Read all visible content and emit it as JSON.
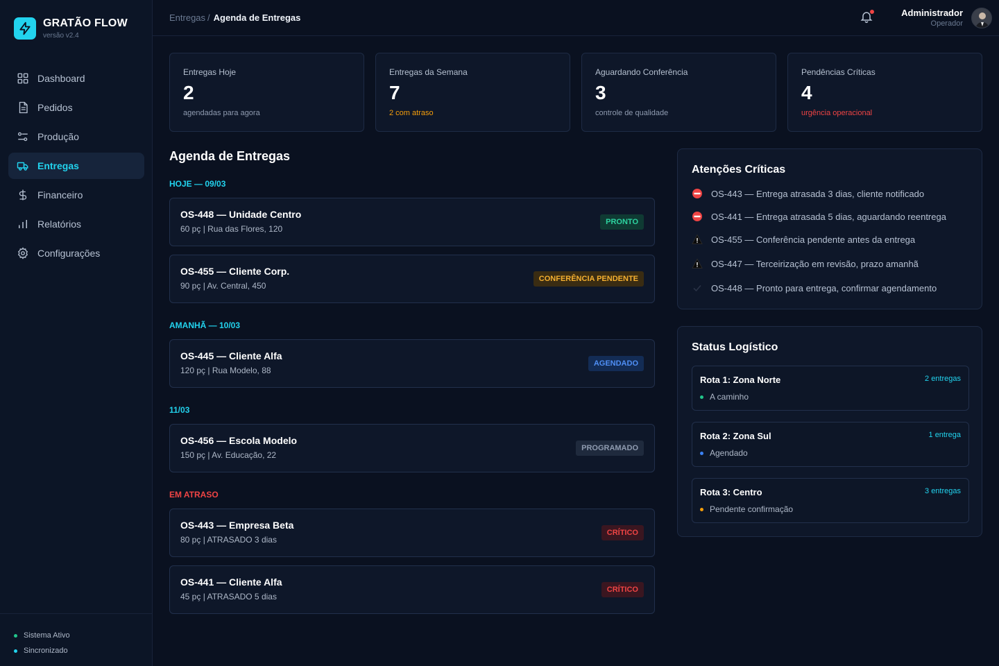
{
  "brand": {
    "name": "GRATÃO FLOW",
    "version": "versão v2.4"
  },
  "nav": [
    {
      "label": "Dashboard",
      "icon": "dashboard-icon"
    },
    {
      "label": "Pedidos",
      "icon": "document-icon"
    },
    {
      "label": "Produção",
      "icon": "sliders-icon"
    },
    {
      "label": "Entregas",
      "icon": "truck-icon",
      "active": true
    },
    {
      "label": "Financeiro",
      "icon": "dollar-icon"
    },
    {
      "label": "Relatórios",
      "icon": "bar-chart-icon"
    },
    {
      "label": "Configurações",
      "icon": "gear-icon"
    }
  ],
  "system_status": [
    {
      "label": "Sistema Ativo",
      "color": "#22c58b"
    },
    {
      "label": "Sincronizado",
      "color": "#22d3ee"
    }
  ],
  "breadcrumb": {
    "parent": "Entregas",
    "separator": "/",
    "current": "Agenda de Entregas"
  },
  "user": {
    "name": "Administrador",
    "role": "Operador"
  },
  "stats": [
    {
      "label": "Entregas Hoje",
      "value": "2",
      "sub": "agendadas para agora"
    },
    {
      "label": "Entregas da Semana",
      "value": "7",
      "sub": "2 com atraso"
    },
    {
      "label": "Aguardando Conferência",
      "value": "3",
      "sub": "controle de qualidade"
    },
    {
      "label": "Pendências Críticas",
      "value": "4",
      "sub": "urgência operacional"
    }
  ],
  "agenda": {
    "title": "Agenda de Entregas",
    "groups": [
      {
        "label": "HOJE — 09/03",
        "items": [
          {
            "title": "OS-448 — Unidade Centro",
            "meta": "60 pç | Rua das Flores, 120",
            "badge": "PRONTO"
          },
          {
            "title": "OS-455 — Cliente Corp.",
            "meta": "90 pç | Av. Central, 450",
            "badge": "CONFERÊNCIA PENDENTE"
          }
        ]
      },
      {
        "label": "AMANHÃ — 10/03",
        "items": [
          {
            "title": "OS-445 — Cliente Alfa",
            "meta": "120 pç | Rua Modelo, 88",
            "badge": "AGENDADO"
          }
        ]
      },
      {
        "label": "11/03",
        "items": [
          {
            "title": "OS-456 — Escola Modelo",
            "meta": "150 pç | Av. Educação, 22",
            "badge": "PROGRAMADO"
          }
        ]
      },
      {
        "label": "EM ATRASO",
        "items": [
          {
            "title": "OS-443 — Empresa Beta",
            "meta": "80 pç | ATRASADO 3 dias",
            "badge": "CRÍTICO"
          },
          {
            "title": "OS-441 — Cliente Alfa",
            "meta": "45 pç | ATRASADO 5 dias",
            "badge": "CRÍTICO"
          }
        ]
      }
    ]
  },
  "alerts": {
    "title": "Atenções Críticas",
    "items": [
      {
        "icon": "no-entry-icon",
        "text": "OS-443 — Entrega atrasada 3 dias, cliente notificado"
      },
      {
        "icon": "no-entry-icon",
        "text": "OS-441 — Entrega atrasada 5 dias, aguardando reentrega"
      },
      {
        "icon": "warning-icon",
        "text": "OS-455 — Conferência pendente antes da entrega"
      },
      {
        "icon": "warning-icon",
        "text": "OS-447 — Terceirização em revisão, prazo amanhã"
      },
      {
        "icon": "check-icon",
        "text": "OS-448 — Pronto para entrega, confirmar agendamento"
      }
    ]
  },
  "logistics": {
    "title": "Status Logístico",
    "routes": [
      {
        "name": "Rota 1: Zona Norte",
        "count": "2 entregas",
        "status": "A caminho",
        "color": "#22c58b"
      },
      {
        "name": "Rota 2: Zona Sul",
        "count": "1 entrega",
        "status": "Agendado",
        "color": "#3b82f6"
      },
      {
        "name": "Rota 3: Centro",
        "count": "3 entregas",
        "status": "Pendente confirmação",
        "color": "#f59e0b"
      }
    ]
  }
}
